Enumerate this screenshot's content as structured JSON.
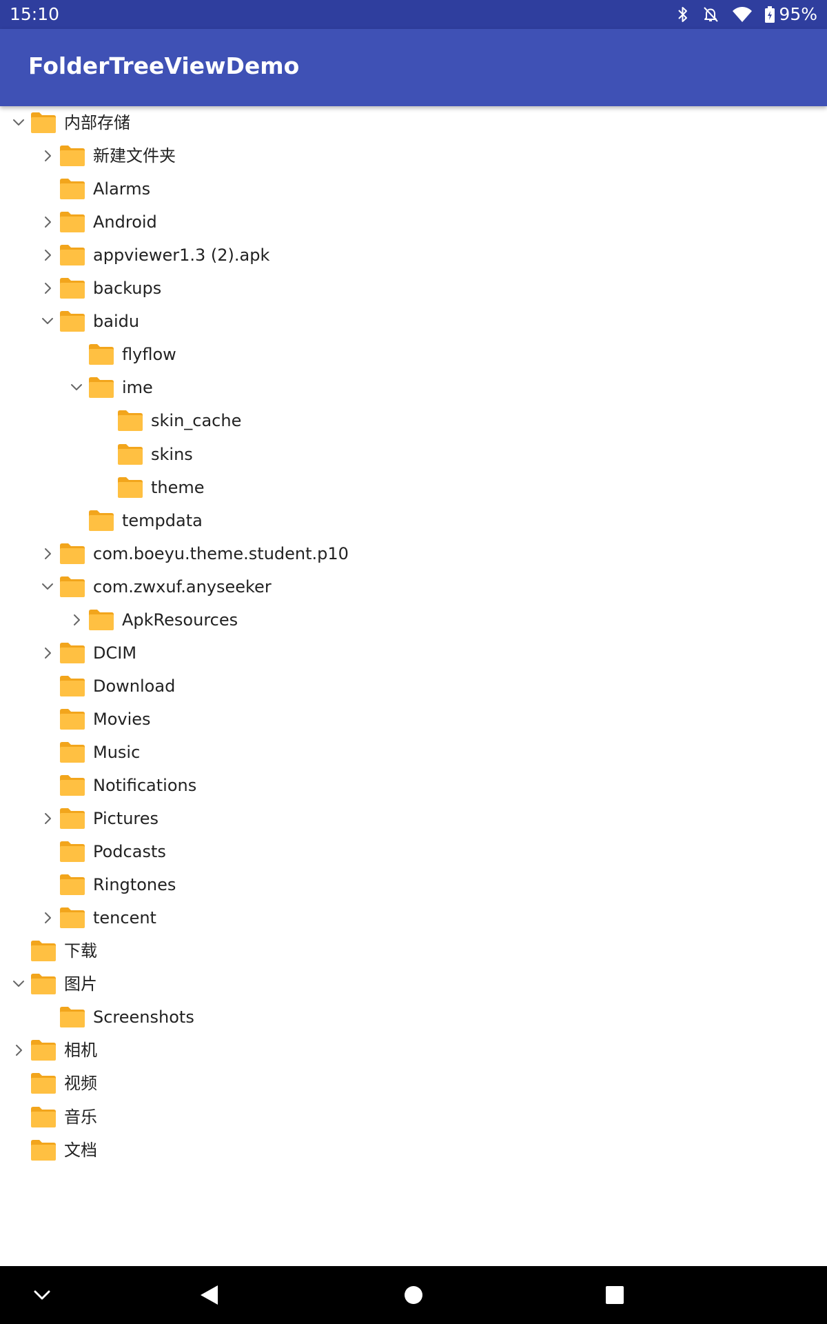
{
  "status_bar": {
    "time": "15:10",
    "battery": "95%",
    "icons": [
      "bluetooth-icon",
      "notifications-off-icon",
      "wifi-icon",
      "battery-icon"
    ]
  },
  "app_bar": {
    "title": "FolderTreeViewDemo",
    "color": "#3f51b5"
  },
  "colors": {
    "status_bar": "#2f3e9e",
    "folder": "#ffc042",
    "folder_tab": "#f2a51c",
    "text": "#222222"
  },
  "tree": [
    {
      "label": "内部存储",
      "depth": 0,
      "expander": "expanded"
    },
    {
      "label": "新建文件夹",
      "depth": 1,
      "expander": "collapsed"
    },
    {
      "label": "Alarms",
      "depth": 1,
      "expander": "none"
    },
    {
      "label": "Android",
      "depth": 1,
      "expander": "collapsed"
    },
    {
      "label": "appviewer1.3 (2).apk",
      "depth": 1,
      "expander": "collapsed"
    },
    {
      "label": "backups",
      "depth": 1,
      "expander": "collapsed"
    },
    {
      "label": "baidu",
      "depth": 1,
      "expander": "expanded"
    },
    {
      "label": "flyflow",
      "depth": 2,
      "expander": "none"
    },
    {
      "label": "ime",
      "depth": 2,
      "expander": "expanded"
    },
    {
      "label": "skin_cache",
      "depth": 3,
      "expander": "none"
    },
    {
      "label": "skins",
      "depth": 3,
      "expander": "none"
    },
    {
      "label": "theme",
      "depth": 3,
      "expander": "none"
    },
    {
      "label": "tempdata",
      "depth": 2,
      "expander": "none"
    },
    {
      "label": "com.boeyu.theme.student.p10",
      "depth": 1,
      "expander": "collapsed"
    },
    {
      "label": "com.zwxuf.anyseeker",
      "depth": 1,
      "expander": "expanded"
    },
    {
      "label": "ApkResources",
      "depth": 2,
      "expander": "collapsed"
    },
    {
      "label": "DCIM",
      "depth": 1,
      "expander": "collapsed"
    },
    {
      "label": "Download",
      "depth": 1,
      "expander": "none"
    },
    {
      "label": "Movies",
      "depth": 1,
      "expander": "none"
    },
    {
      "label": "Music",
      "depth": 1,
      "expander": "none"
    },
    {
      "label": "Notifications",
      "depth": 1,
      "expander": "none"
    },
    {
      "label": "Pictures",
      "depth": 1,
      "expander": "collapsed"
    },
    {
      "label": "Podcasts",
      "depth": 1,
      "expander": "none"
    },
    {
      "label": "Ringtones",
      "depth": 1,
      "expander": "none"
    },
    {
      "label": "tencent",
      "depth": 1,
      "expander": "collapsed"
    },
    {
      "label": "下载",
      "depth": 0,
      "expander": "none"
    },
    {
      "label": "图片",
      "depth": 0,
      "expander": "expanded"
    },
    {
      "label": "Screenshots",
      "depth": 1,
      "expander": "none"
    },
    {
      "label": "相机",
      "depth": 0,
      "expander": "collapsed"
    },
    {
      "label": "视频",
      "depth": 0,
      "expander": "none"
    },
    {
      "label": "音乐",
      "depth": 0,
      "expander": "none"
    },
    {
      "label": "文档",
      "depth": 0,
      "expander": "none"
    }
  ],
  "nav_bar": {
    "buttons": [
      "hide-keyboard-icon",
      "back-icon",
      "home-icon",
      "recents-icon"
    ]
  }
}
